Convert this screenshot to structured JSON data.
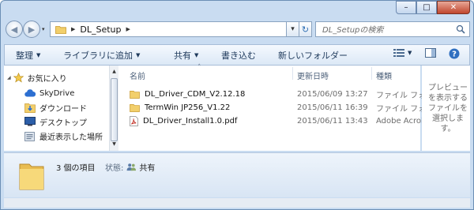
{
  "window": {
    "minimize_glyph": "–",
    "maximize_glyph": "□",
    "close_glyph": "✕"
  },
  "address": {
    "crumb": "DL_Setup",
    "separator": "▶",
    "refresh_glyph": "↻",
    "dropdown_glyph": "▾"
  },
  "search": {
    "placeholder": "DL_Setupの検索"
  },
  "toolbar": {
    "organize": "整理",
    "add_to_library": "ライブラリに追加",
    "share": "共有",
    "burn": "書き込む",
    "new_folder": "新しいフォルダー",
    "dropdown_glyph": "▼"
  },
  "nav_pane": {
    "items": [
      {
        "label": "お気に入り",
        "icon": "star-icon"
      },
      {
        "label": "SkyDrive",
        "icon": "cloud-icon"
      },
      {
        "label": "ダウンロード",
        "icon": "download-folder-icon"
      },
      {
        "label": "デスクトップ",
        "icon": "desktop-icon"
      },
      {
        "label": "最近表示した場所",
        "icon": "recent-places-icon"
      }
    ]
  },
  "file_list": {
    "columns": {
      "name": "名前",
      "date": "更新日時",
      "type": "種類"
    },
    "sort_glyph": "˄",
    "files": [
      {
        "name": "DL_Driver_CDM_V2.12.18",
        "date": "2015/06/09 13:27",
        "type": "ファイル フォ",
        "icon": "folder-icon"
      },
      {
        "name": "TermWin JP256_V1.22",
        "date": "2015/06/11 16:39",
        "type": "ファイル フォ",
        "icon": "folder-icon"
      },
      {
        "name": "DL_Driver_Install1.0.pdf",
        "date": "2015/06/11 13:43",
        "type": "Adobe Acroba",
        "icon": "pdf-icon"
      }
    ]
  },
  "preview_pane": {
    "text": "プレビューを表示するファイルを選択します。"
  },
  "details": {
    "item_count": "3 個の項目",
    "status_label": "状態:",
    "status_value": "共有"
  },
  "colors": {
    "frame": "#c9dcf1",
    "folder": "#f2cf6b",
    "accent": "#1e395b"
  }
}
